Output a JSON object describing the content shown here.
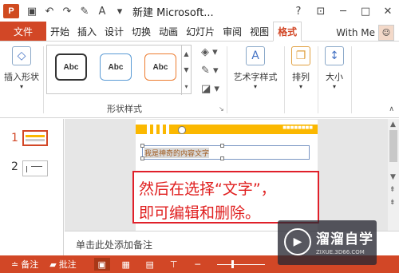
{
  "titlebar": {
    "app_icon": "P",
    "doc_title": "新建 Microsoft...",
    "quick_access": [
      "save-icon",
      "undo-icon",
      "redo-icon",
      "customize-icon"
    ],
    "win_buttons": [
      "?",
      "□",
      "─",
      "□",
      "✕"
    ]
  },
  "tabs": [
    {
      "label": "文件"
    },
    {
      "label": "开始"
    },
    {
      "label": "插入"
    },
    {
      "label": "设计"
    },
    {
      "label": "切换"
    },
    {
      "label": "动画"
    },
    {
      "label": "幻灯片"
    },
    {
      "label": "审阅"
    },
    {
      "label": "视图"
    },
    {
      "label": "格式"
    }
  ],
  "account": {
    "label": "With Me"
  },
  "ribbon": {
    "insert_shape": "插入形状",
    "styles": [
      "Abc",
      "Abc",
      "Abc"
    ],
    "style_colors": [
      "#333333",
      "#5b9bd5",
      "#ed7d31"
    ],
    "shape_styles_label": "形状样式",
    "art_text": "艺术字样式",
    "arrange": "排列",
    "size": "大小"
  },
  "slides_pane": {
    "nums": [
      "1",
      "2"
    ]
  },
  "slide": {
    "textbox_text": "我是神奇的内容文字",
    "bar_text": "■■■■■■■■"
  },
  "annotation": {
    "line1": "然后在选择“文字”，",
    "line2": "即可编辑和删除。"
  },
  "notes": {
    "placeholder": "单击此处添加备注"
  },
  "statusbar": {
    "notes": "备注",
    "comments": "批注"
  },
  "watermark": {
    "title": "溜溜自学",
    "sub": "ZIXUE.3D66.COM"
  },
  "colors": {
    "accent": "#d24726",
    "highlight": "#e0202a",
    "bar": "#fbb800"
  }
}
